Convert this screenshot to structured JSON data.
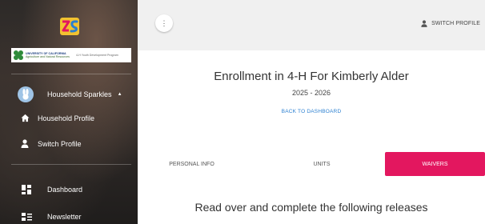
{
  "sidebar": {
    "logo_icon": "zsuite-logo-icon",
    "banner": {
      "org_line1": "UNIVERSITY OF CALIFORNIA",
      "org_line2": "Agriculture and Natural Resources",
      "program": "4-H Youth Development Program"
    },
    "household": {
      "label": "Household Sparkles",
      "avatar_icon": "bunny-avatar-icon",
      "caret": "▲"
    },
    "items": [
      {
        "label": "Household Profile",
        "icon": "home-icon"
      },
      {
        "label": "Switch Profile",
        "icon": "person-icon"
      },
      {
        "label": "Dashboard",
        "icon": "dashboard-icon"
      },
      {
        "label": "Newsletter",
        "icon": "newsletter-icon"
      }
    ]
  },
  "topbar": {
    "menu_icon": "kebab-menu-icon",
    "kebab_glyph": "⋮",
    "switch_profile_label": "SWITCH PROFILE"
  },
  "enrollment": {
    "title": "Enrollment in 4-H For Kimberly Alder",
    "year": "2025 - 2026",
    "back_link": "BACK TO DASHBOARD"
  },
  "tabs": [
    {
      "label": "PERSONAL INFO",
      "active": false
    },
    {
      "label": "UNITS",
      "active": false
    },
    {
      "label": "WAIVERS",
      "active": true
    }
  ],
  "waivers": {
    "heading": "Read over and complete the following releases"
  },
  "colors": {
    "accent": "#e3175f",
    "link": "#2a7fd0"
  }
}
